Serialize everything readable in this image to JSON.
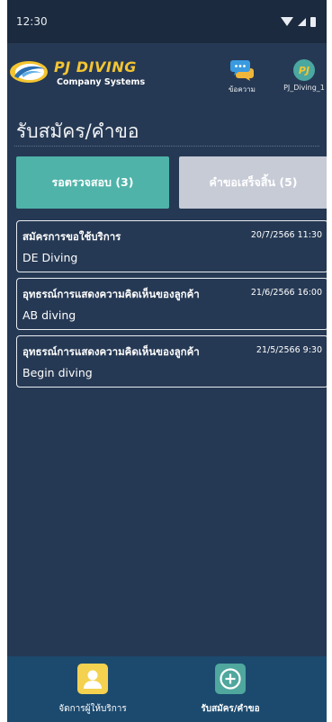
{
  "status_bar": {
    "time": "12:30"
  },
  "header": {
    "brand_title": "PJ DIVING",
    "brand_subtitle": "Company Systems",
    "messages_label": "ข้อความ",
    "user_initials": "PJ",
    "user_name": "PJ_Diving_1"
  },
  "page": {
    "title": "รับสมัคร/คำขอ"
  },
  "tabs": [
    {
      "label": "รอตรวจสอบ (3)",
      "active": true
    },
    {
      "label": "คำขอเสร็จสิ้น (5)",
      "active": false
    }
  ],
  "requests": [
    {
      "title": "สมัครการขอใช้บริการ",
      "date": "20/7/2566 11:30",
      "name": "DE Diving"
    },
    {
      "title": "อุทธรณ์การแสดงความคิดเห็นของลูกค้า",
      "date": "21/6/2566 16:00",
      "name": "AB diving"
    },
    {
      "title": "อุทธรณ์การแสดงความคิดเห็นของลูกค้า",
      "date": "21/5/2566 9:30",
      "name": "Begin diving"
    }
  ],
  "bottom_nav": [
    {
      "label": "จัดการผู้ให้บริการ",
      "icon": "user-icon",
      "active": false
    },
    {
      "label": "รับสมัคร/คำขอ",
      "icon": "add-circle-icon",
      "active": true
    }
  ],
  "colors": {
    "background": "#263954",
    "brand_yellow": "#f4c531",
    "tab_active": "#4fb3a9",
    "tab_inactive": "#c7cbd6",
    "bottom_nav": "#1c4a6e"
  }
}
